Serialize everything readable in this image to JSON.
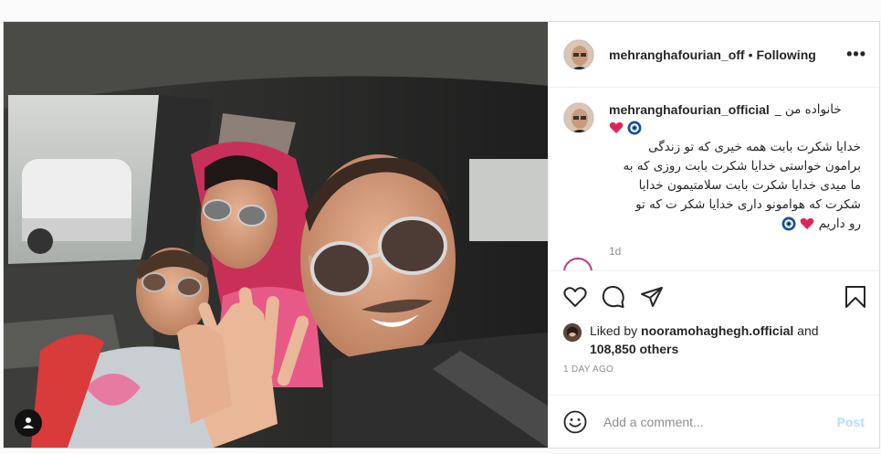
{
  "header": {
    "username": "mehranghafourian_off",
    "separator": "•",
    "follow_state": "Following",
    "more_label": "•••"
  },
  "caption": {
    "username": "mehranghafourian_official",
    "first_line": "خانواده من _",
    "text": "خدایا شکرت بابت همه خیری که تو زندگی برامون خواستی خدایا شکرت بابت روزی که به ما میدی خدایا شکرت بابت سلامتیمون خدایا شکرت که هوامونو داری خدایا شکر ت که تو",
    "last_line": "رو داریم",
    "time": "1d",
    "emoji_heart_color": "#e0245e",
    "emoji_eye_color": "#1d4e9e"
  },
  "actions": {
    "like_icon": "heart-outline-icon",
    "comment_icon": "comment-icon",
    "share_icon": "paper-plane-icon",
    "save_icon": "bookmark-icon"
  },
  "likes": {
    "prefix": "Liked by",
    "liker": "nooramohaghegh.official",
    "joiner": "and",
    "others": "108,850 others"
  },
  "posted": "1 DAY AGO",
  "comment_box": {
    "placeholder": "Add a comment...",
    "post_label": "Post",
    "emoji_icon": "smiley-icon"
  },
  "media": {
    "tag_icon": "user-tag-icon"
  }
}
